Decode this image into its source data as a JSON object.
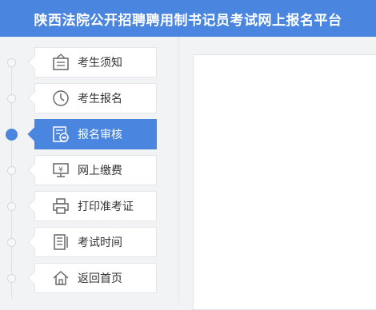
{
  "header": {
    "title": "陕西法院公开招聘聘用制书记员考试网上报名平台"
  },
  "nav": {
    "active_index": 2,
    "accent": "#4a86df",
    "items": [
      {
        "label": "考生须知",
        "icon": "notice-board-icon"
      },
      {
        "label": "考生报名",
        "icon": "clock-icon"
      },
      {
        "label": "报名审核",
        "icon": "review-icon"
      },
      {
        "label": "网上缴费",
        "icon": "payment-monitor-icon"
      },
      {
        "label": "打印准考证",
        "icon": "printer-icon"
      },
      {
        "label": "考试时间",
        "icon": "document-icon"
      },
      {
        "label": "返回首页",
        "icon": "home-icon"
      }
    ]
  }
}
